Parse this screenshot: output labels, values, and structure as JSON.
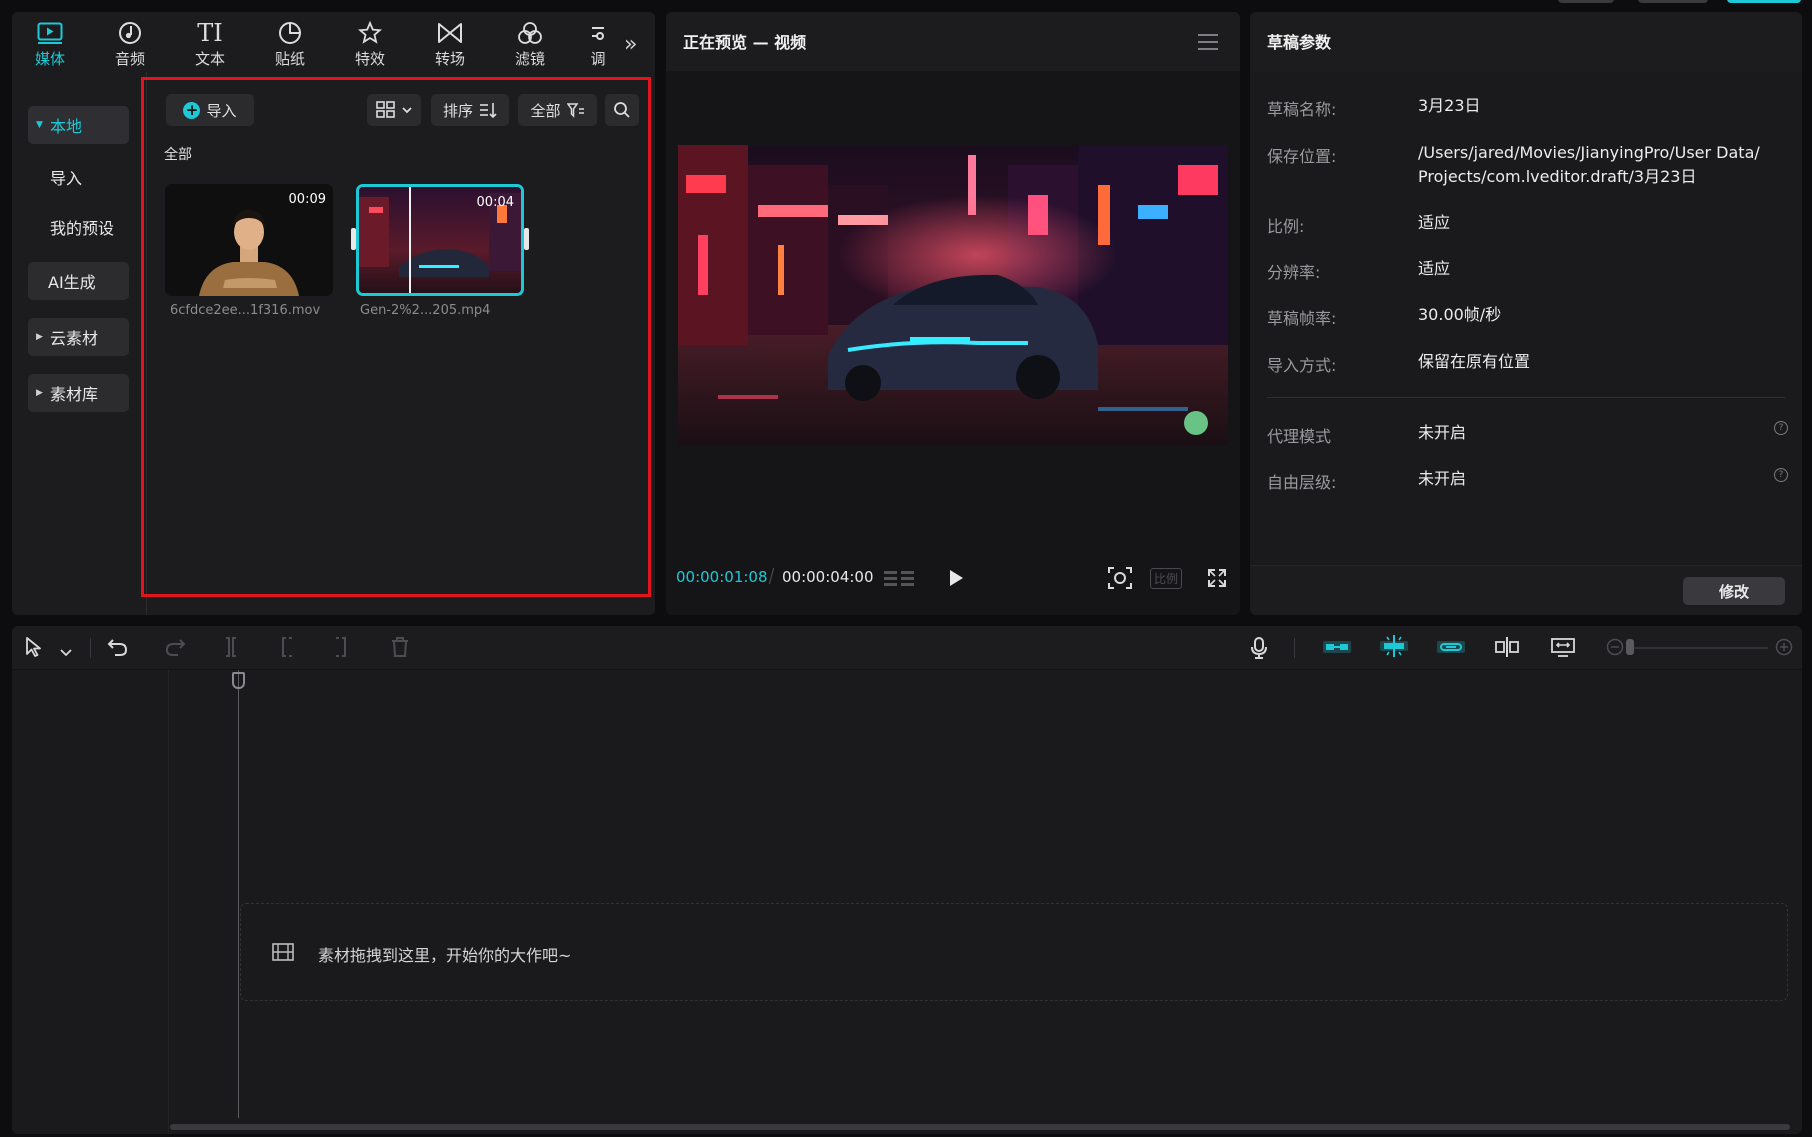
{
  "colors": {
    "accent": "#1ec9d6",
    "highlight_box": "#e3151c",
    "background": "#0d0d0f"
  },
  "toolbar": {
    "tabs": [
      {
        "label": "媒体",
        "icon": "media-icon"
      },
      {
        "label": "音频",
        "icon": "audio-icon"
      },
      {
        "label": "文本",
        "icon": "text-icon",
        "glyph": "TI"
      },
      {
        "label": "贴纸",
        "icon": "sticker-icon"
      },
      {
        "label": "特效",
        "icon": "effects-icon"
      },
      {
        "label": "转场",
        "icon": "transition-icon"
      },
      {
        "label": "滤镜",
        "icon": "filter-icon"
      },
      {
        "label": "调",
        "icon": "adjust-icon"
      }
    ],
    "more": "»"
  },
  "sidebar": {
    "items": [
      {
        "label": "本地",
        "state": "active-expanded"
      },
      {
        "label": "导入"
      },
      {
        "label": "我的预设"
      },
      {
        "label": "AI生成"
      },
      {
        "label": "云素材",
        "state": "collapsed"
      },
      {
        "label": "素材库",
        "state": "collapsed"
      }
    ]
  },
  "media": {
    "import_label": "导入",
    "sort_label": "排序",
    "filter_label": "全部",
    "section_label": "全部",
    "items": [
      {
        "duration": "00:09",
        "name": "6cfdce2ee...1f316.mov"
      },
      {
        "duration": "00:04",
        "name": "Gen-2%2...205.mp4",
        "selected": true
      }
    ]
  },
  "preview": {
    "title": "正在预览 — 视频",
    "current_time": "00:00:01:08",
    "total_time": "00:00:04:00",
    "ratio_label": "比例"
  },
  "draft": {
    "title": "草稿参数",
    "fields": [
      {
        "key": "草稿名称:",
        "value": "3月23日"
      },
      {
        "key": "保存位置:",
        "value_lines": [
          "/Users/jared/Movies/JianyingPro/User Data/",
          "Projects/com.lveditor.draft/3月23日"
        ]
      },
      {
        "key": "比例:",
        "value": "适应"
      },
      {
        "key": "分辨率:",
        "value": "适应"
      },
      {
        "key": "草稿帧率:",
        "value": "30.00帧/秒"
      },
      {
        "key": "导入方式:",
        "value": "保留在原有位置"
      },
      {
        "key": "代理模式",
        "value": "未开启"
      },
      {
        "key": "自由层级:",
        "value": "未开启"
      }
    ],
    "help_glyph": "?",
    "modify_label": "修改"
  },
  "timeline": {
    "drop_hint": "素材拖拽到这里，开始你的大作吧~"
  }
}
